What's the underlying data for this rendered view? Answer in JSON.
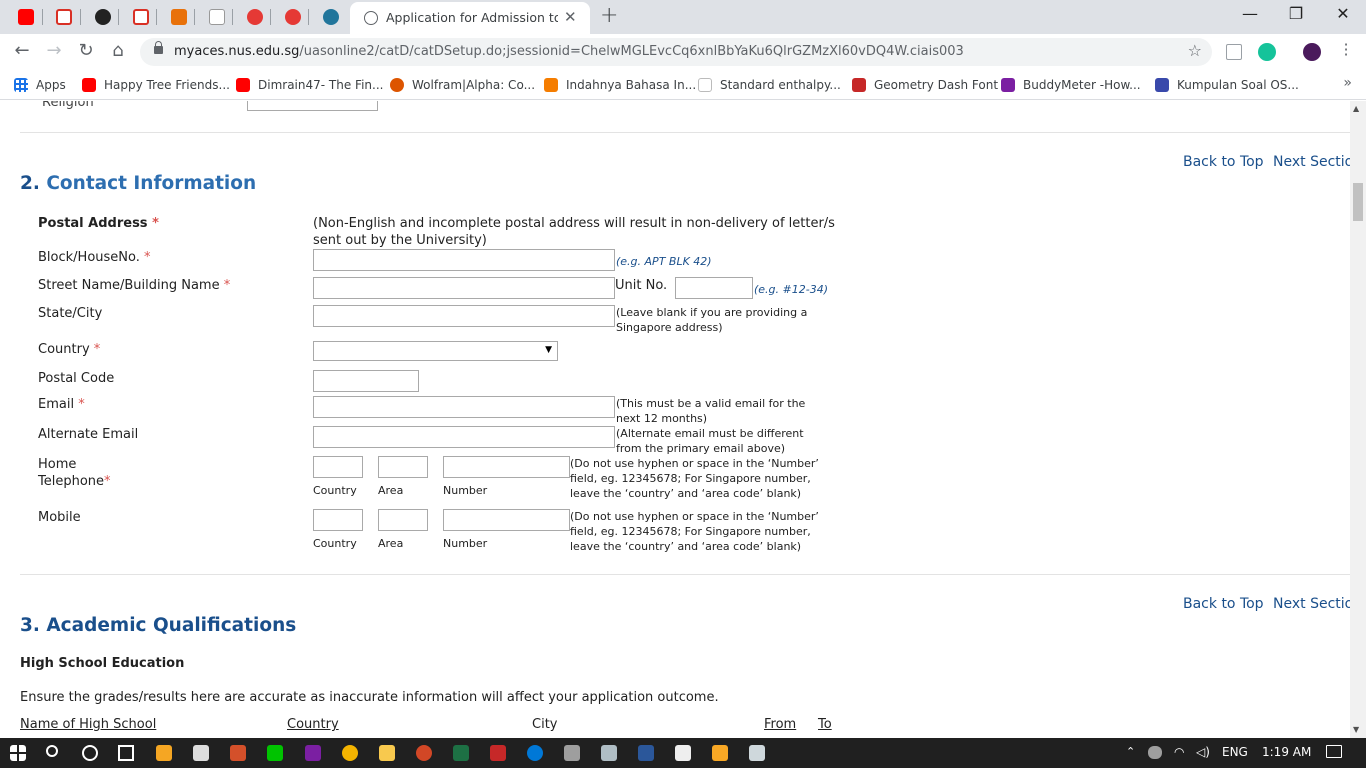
{
  "browser": {
    "tab_title": "Application for Admission to full",
    "tab_close": "✕",
    "new_tab": "+",
    "url_host": "myaces.nus.edu.sg",
    "url_path": "/uasonline2/catD/catDSetup.do;jsessionid=ChelwMGLEvcCq6xnlBbYaKu6QlrGZMzXl60vDQ4W.ciais003",
    "window_controls": [
      "—",
      "❐",
      "✕"
    ],
    "bookmarks": [
      {
        "label": "Apps",
        "color": "#1a73e8"
      },
      {
        "label": "Happy Tree Friends...",
        "color": "#ff0000"
      },
      {
        "label": "Dimrain47- The Fin...",
        "color": "#ff0000"
      },
      {
        "label": "Wolfram|Alpha: Co...",
        "color": "#dd5500"
      },
      {
        "label": "Indahnya Bahasa In...",
        "color": "#f57d00"
      },
      {
        "label": "Standard enthalpy...",
        "color": "#ffffff"
      },
      {
        "label": "Geometry Dash Font",
        "color": "#c62828"
      },
      {
        "label": "BuddyMeter -How...",
        "color": "#7b1fa2"
      },
      {
        "label": "Kumpulan Soal OS...",
        "color": "#3949ab"
      }
    ],
    "bookmarks_more": "»"
  },
  "page": {
    "prev_label": "Religion",
    "back_to_top": "Back to Top",
    "next_section": "Next Section",
    "section2": {
      "number": "2.",
      "title": "Contact Information"
    },
    "postal_address_label": "Postal Address",
    "postal_address_note": "(Non-English and incomplete postal address will result in non-delivery of letter/s sent out by the University)",
    "required_mark": "*",
    "fields": {
      "block": {
        "label": "Block/HouseNo.",
        "hint": "(e.g. APT BLK 42)",
        "value": ""
      },
      "street": {
        "label": "Street Name/Building Name",
        "value": ""
      },
      "unit": {
        "label": "Unit No.",
        "hint": "(e.g. #12-34)",
        "value": ""
      },
      "state": {
        "label": "State/City",
        "hint": "(Leave blank if you are providing a Singapore address)",
        "value": ""
      },
      "country": {
        "label": "Country",
        "value": ""
      },
      "postal_code": {
        "label": "Postal Code",
        "value": ""
      },
      "email": {
        "label": "Email",
        "hint": "(This must be a valid email for the next 12 months)",
        "value": ""
      },
      "alt_email": {
        "label": "Alternate Email",
        "hint": "(Alternate email must be different from the primary email above)",
        "value": ""
      },
      "home_tel": {
        "label_line1": "Home",
        "label_line2": "Telephone",
        "hint": "(Do not use hyphen or space in the ‘Number’ field, eg. 12345678; For Singapore number, leave the ‘country’ and ‘area code’ blank)"
      },
      "mobile": {
        "label": "Mobile",
        "hint": "(Do not use hyphen or space in the ‘Number’ field, eg. 12345678; For Singapore number, leave the ‘country’ and ‘area code’ blank)"
      }
    },
    "phone_sublabels": {
      "country": "Country",
      "area": "Area",
      "number": "Number"
    },
    "section3": {
      "number": "3.",
      "title": "Academic Qualifications"
    },
    "high_school_heading": "High School Education",
    "grades_note": "Ensure the grades/results here are accurate as inaccurate information will affect your application outcome.",
    "columns": [
      "Name of High School",
      "Country",
      "City",
      "From",
      "To"
    ]
  },
  "taskbar": {
    "language": "ENG",
    "time": "1:19 AM"
  },
  "colors": {
    "link": "#1a4f8b",
    "section_title": "#2d6eb0",
    "required": "#d9534f",
    "taskbar": "#202020"
  }
}
